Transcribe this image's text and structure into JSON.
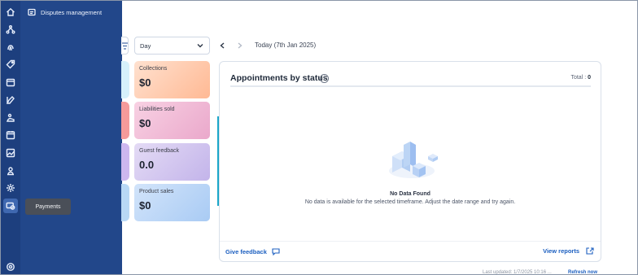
{
  "flyout": {
    "item_label": "Disputes management"
  },
  "tooltip": {
    "text": "Payments"
  },
  "toolbar": {
    "period_value": "Day",
    "date_label": "Today (7th Jan 2025)"
  },
  "cards": [
    {
      "label": "Collections",
      "value": "$0"
    },
    {
      "label": "Liabilities sold",
      "value": "$0"
    },
    {
      "label": "Guest feedback",
      "value": "0.0"
    },
    {
      "label": "Product sales",
      "value": "$0"
    }
  ],
  "appointments": {
    "title": "Appointments by status",
    "total_label": "Total : ",
    "total_value": "0",
    "empty_title": "No Data Found",
    "empty_desc": "No data is available for the selected timeframe. Adjust the date range and try again.",
    "feedback_label": "Give feedback",
    "view_reports_label": "View reports"
  },
  "footer": {
    "status": "Last updated: 1/7/2025 10:16 ...",
    "refresh": "Refresh now"
  },
  "colors": {
    "rail": "#1d3f7e",
    "flyout": "#22478a",
    "link": "#1c5fc0",
    "card_collections": "#ffd3bd",
    "card_liabilities": "#f4bfd7",
    "card_guest": "#d6c8ef",
    "card_product": "#b9d4f5"
  },
  "icons": [
    "home-icon",
    "network-icon",
    "fingerprint-icon",
    "tag-icon",
    "calendar-check-icon",
    "rocket-icon",
    "hand-heart-icon",
    "calendar-icon",
    "image-icon",
    "user-badge-icon",
    "gear-cog-icon",
    "payments-icon",
    "settings-icon",
    "disputes-icon",
    "filter-icon",
    "chevron-down-icon",
    "chevron-left-icon",
    "chevron-right-icon",
    "info-icon",
    "feedback-icon",
    "external-link-icon"
  ]
}
